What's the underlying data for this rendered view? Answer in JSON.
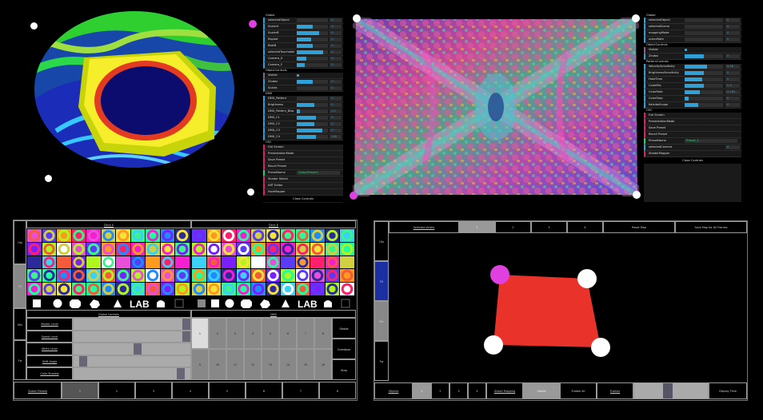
{
  "colors": {
    "gui_number": "#2fa1d6",
    "gui_bool": "#806787",
    "gui_func": "#e61d5f",
    "gui_string": "#1ed36f",
    "quad_red": "#e8322a",
    "handle_magenta": "#e040e0"
  },
  "gui_left": {
    "title": "Global",
    "global_rows": [
      {
        "label": "selectedObject",
        "value": "0",
        "fill": 0
      },
      {
        "label": "Scaler4",
        "value": "0",
        "fill": 0.5
      },
      {
        "label": "ScalerB",
        "value": "0",
        "fill": 0.7
      },
      {
        "label": "Repeat",
        "value": "0",
        "fill": 0.45
      },
      {
        "label": "RostB",
        "value": "0",
        "fill": 0.5
      },
      {
        "label": "selectedTouchable",
        "value": "0",
        "fill": 0.85
      },
      {
        "label": "Camera_X",
        "value": "0",
        "fill": 0.3
      },
      {
        "label": "Camera_Y",
        "value": "0",
        "fill": 0.25
      }
    ],
    "object_title": "ObjectControls",
    "object_rows": [
      {
        "label": "Visible",
        "value": "",
        "fill": 0,
        "kind": "bool"
      },
      {
        "label": "Zindex",
        "value": "0",
        "fill": 0.5
      },
      {
        "label": "Scales",
        "value": "0",
        "fill": 0
      }
    ],
    "dmx_title": "DMX",
    "dmx_rows": [
      {
        "label": "DMX_Pattern",
        "value": "0",
        "fill": 0
      },
      {
        "label": "Brightness",
        "value": "0",
        "fill": 0.55
      },
      {
        "label": "DMX_Pattern_Bias",
        "value": "0.1",
        "fill": 0.1
      },
      {
        "label": "DMX_C1",
        "value": "0",
        "fill": 0.6
      },
      {
        "label": "DMX_C2",
        "value": "0",
        "fill": 0.55
      },
      {
        "label": "DMX_C3",
        "value": "0",
        "fill": 0.8
      },
      {
        "label": "DMX_C4",
        "value": "100",
        "fill": 0.6
      }
    ],
    "osc_title": "OSC",
    "osc_rows": [
      {
        "label": "Full Screen",
        "kind": "func"
      },
      {
        "label": "PresentationMode",
        "kind": "func"
      },
      {
        "label": "Save Preset",
        "kind": "func"
      },
      {
        "label": "Recall Preset",
        "kind": "func"
      },
      {
        "label": "PresetName",
        "kind": "str",
        "text": "GlobalPreset1"
      },
      {
        "label": "Shader Select",
        "kind": "func"
      },
      {
        "label": "ART Editor",
        "kind": "func"
      },
      {
        "label": "FaceMapper",
        "kind": "func"
      }
    ],
    "close": "Close Controls"
  },
  "gui_right": {
    "title": "Global",
    "global_rows": [
      {
        "label": "selectedObject",
        "value": "0",
        "fill": 0
      },
      {
        "label": "selectedScene",
        "value": "0",
        "fill": 0
      },
      {
        "label": "mappingMode",
        "value": "0",
        "fill": 0
      },
      {
        "label": "sceneRate",
        "value": "0",
        "fill": 0
      }
    ],
    "object_title": "ObjectControls",
    "object_rows": [
      {
        "label": "Visible",
        "value": "",
        "fill": 0,
        "kind": "bool"
      },
      {
        "label": "Zindex",
        "value": "0",
        "fill": 0.5
      }
    ],
    "pattern_title": "PatternControls",
    "pattern_rows": [
      {
        "label": "VelocitySensitivity",
        "value": "0.58",
        "fill": 0.58
      },
      {
        "label": "BrightnessSensitivity",
        "value": "0",
        "fill": 0.5
      },
      {
        "label": "FadeTime",
        "value": "0",
        "fill": 0.45
      },
      {
        "label": "ColorMix",
        "value": "0.3",
        "fill": 0.5
      },
      {
        "label": "ColorRate",
        "value": "0.165",
        "fill": 0.4
      },
      {
        "label": "ColorStep",
        "value": "0",
        "fill": 0.1
      },
      {
        "label": "KaleidoScope",
        "value": "0",
        "fill": 0.35
      }
    ],
    "osc_title": "OSC",
    "osc_rows": [
      {
        "label": "Full Screen",
        "kind": "func"
      },
      {
        "label": "PresentationMode",
        "kind": "func"
      },
      {
        "label": "Save Preset",
        "kind": "func"
      },
      {
        "label": "Recall Preset",
        "kind": "func"
      },
      {
        "label": "PresetName",
        "kind": "str",
        "text": "Preset_1"
      },
      {
        "label": "selectedCamera",
        "kind": "num",
        "value": "0"
      },
      {
        "label": "ShaderMapper",
        "kind": "func"
      }
    ],
    "close": "Close Controls"
  },
  "touch_left": {
    "side_tabs": [
      "Obj",
      "FX",
      "Mix",
      "Fw"
    ],
    "deck_a": "Deck A",
    "deck_b": "Deck B",
    "shape_label": "LAB",
    "global_controls": "Global Controls",
    "global_rows": [
      "Master Level",
      "Speed Level",
      "Width Level",
      "Shift Angle",
      "Color Shadow"
    ],
    "global_slider_levels": [
      1.0,
      1.0,
      0.55,
      0.05,
      0.95
    ],
    "dmx_title": "DMX",
    "dmx_row1": [
      "1",
      "2",
      "3",
      "4",
      "5",
      "6",
      "7",
      "8"
    ],
    "dmx_row2": [
      "9",
      "10",
      "11",
      "12",
      "13",
      "14",
      "15",
      "16"
    ],
    "dmx_side": [
      "Strobe",
      "Overdose",
      "Stop"
    ],
    "global_presets": "Global Presets",
    "preset_numbers": [
      "1",
      "2",
      "3",
      "4",
      "5",
      "6",
      "7",
      "8"
    ]
  },
  "touch_right": {
    "side_tabs": [
      "Obj",
      "FX",
      "Mix",
      "Fw"
    ],
    "top": {
      "title": "Selected Vertex",
      "cells": [
        "1",
        "2",
        "3",
        "4"
      ],
      "reset": "Reset Map",
      "save": "Save Map for All Frames"
    },
    "bottom": {
      "objects": "Objects",
      "obj_nums": [
        "1",
        "2",
        "3",
        "4"
      ],
      "global": "Global Mapping",
      "visible": "Visible",
      "enable_all": "Enable All",
      "frames": "Frames",
      "display": "Display Time"
    },
    "frames_slider_level": 0.45
  }
}
